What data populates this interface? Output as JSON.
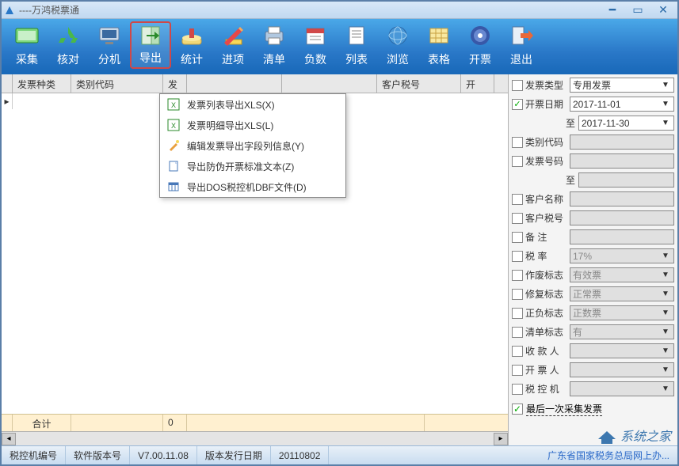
{
  "app": {
    "title": "----万鸿税票通"
  },
  "toolbar": {
    "items": [
      {
        "label": "采集"
      },
      {
        "label": "核对"
      },
      {
        "label": "分机"
      },
      {
        "label": "导出"
      },
      {
        "label": "统计"
      },
      {
        "label": "进项"
      },
      {
        "label": "清单"
      },
      {
        "label": "负数"
      },
      {
        "label": "列表"
      },
      {
        "label": "浏览"
      },
      {
        "label": "表格"
      },
      {
        "label": "开票"
      },
      {
        "label": "退出"
      }
    ]
  },
  "export_menu": {
    "items": [
      {
        "label": "发票列表导出XLS(X)"
      },
      {
        "label": "发票明细导出XLS(L)"
      },
      {
        "label": "编辑发票导出字段列信息(Y)"
      },
      {
        "label": "导出防伪开票标准文本(Z)"
      },
      {
        "label": "导出DOS税控机DBF文件(D)"
      }
    ]
  },
  "grid": {
    "columns": [
      "发票种类",
      "类别代码",
      "发",
      "",
      "",
      "客户税号",
      "开"
    ],
    "footer": {
      "label": "合计",
      "value": "0"
    }
  },
  "filters": {
    "rows": [
      {
        "chk": false,
        "label": "发票类型",
        "value": "专用发票",
        "dd": true,
        "dis": false
      },
      {
        "chk": true,
        "label": "开票日期",
        "value": "2017-11-01",
        "dd": true,
        "dis": false
      },
      {
        "chk": null,
        "label": "至",
        "value": "2017-11-30",
        "dd": true,
        "dis": false,
        "rightlabel": true
      },
      {
        "chk": false,
        "label": "类别代码",
        "value": "",
        "dd": false,
        "dis": true
      },
      {
        "chk": false,
        "label": "发票号码",
        "value": "",
        "dd": false,
        "dis": true
      },
      {
        "chk": null,
        "label": "至",
        "value": "",
        "dd": false,
        "dis": true,
        "rightlabel": true
      },
      {
        "chk": false,
        "label": "客户名称",
        "value": "",
        "dd": false,
        "dis": true
      },
      {
        "chk": false,
        "label": "客户税号",
        "value": "",
        "dd": false,
        "dis": true
      },
      {
        "chk": false,
        "label": "备  注",
        "value": "",
        "dd": false,
        "dis": true
      },
      {
        "chk": false,
        "label": "税  率",
        "value": "17%",
        "dd": true,
        "dis": true
      },
      {
        "chk": false,
        "label": "作废标志",
        "value": "有效票",
        "dd": true,
        "dis": true
      },
      {
        "chk": false,
        "label": "修复标志",
        "value": "正常票",
        "dd": true,
        "dis": true
      },
      {
        "chk": false,
        "label": "正负标志",
        "value": "正数票",
        "dd": true,
        "dis": true
      },
      {
        "chk": false,
        "label": "清单标志",
        "value": "有",
        "dd": true,
        "dis": true
      },
      {
        "chk": false,
        "label": "收 款 人",
        "value": "",
        "dd": true,
        "dis": true
      },
      {
        "chk": false,
        "label": "开 票 人",
        "value": "",
        "dd": true,
        "dis": true
      },
      {
        "chk": false,
        "label": "税 控 机",
        "value": "",
        "dd": true,
        "dis": true
      }
    ],
    "last_collect": {
      "chk": true,
      "label": "最后一次采集发票"
    }
  },
  "status": {
    "s1": "税控机编号",
    "s2": "软件版本号",
    "s3": "V7.00.11.08",
    "s4": "版本发行日期",
    "s5": "20110802",
    "right": "广东省国家税务总局网上办..."
  },
  "watermark": "系统之家"
}
